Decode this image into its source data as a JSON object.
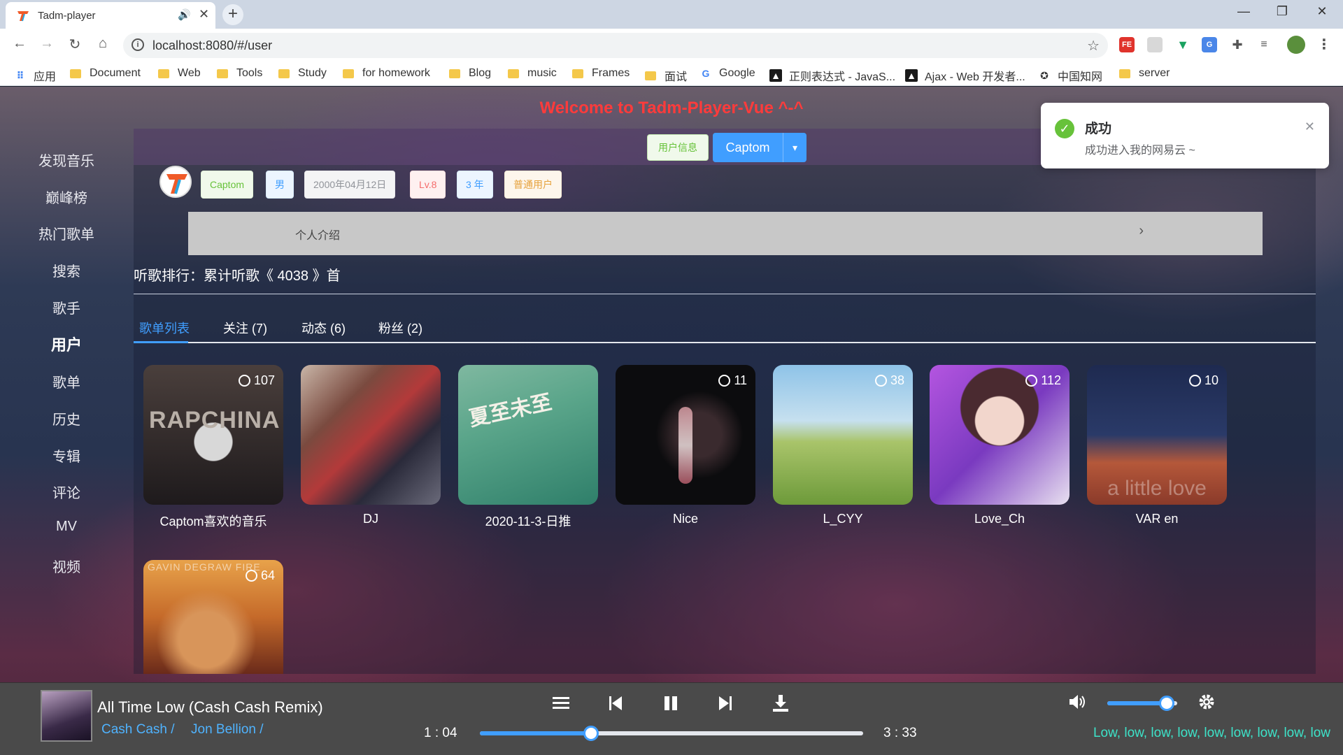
{
  "browser": {
    "tab_title": "Tadm-player",
    "url": "localhost:8080/#/user",
    "bookmarks": [
      "应用",
      "Document",
      "Web",
      "Tools",
      "Study",
      "for homework",
      "Blog",
      "music",
      "Frames",
      "面试",
      "Google",
      "正则表达式 - JavaS...",
      "Ajax - Web 开发者...",
      "中国知网",
      "server"
    ]
  },
  "app": {
    "welcome": "Welcome to Tadm-Player-Vue ^-^",
    "sidebar": [
      "发现音乐",
      "巅峰榜",
      "热门歌单",
      "搜索",
      "歌手",
      "用户",
      "歌单",
      "历史",
      "专辑",
      "评论",
      "MV",
      "视频"
    ],
    "active_sidebar": "用户"
  },
  "user": {
    "info_button": "用户信息",
    "account_button": "Captom",
    "tags": {
      "name": "Captom",
      "gender": "男",
      "birthday": "2000年04月12日",
      "level": "Lv.8",
      "years": "3 年",
      "type": "普通用户"
    },
    "intro_label": "个人介绍",
    "rank_text": "听歌排行：累计听歌《 4038 》首",
    "tabs": [
      "歌单列表",
      "关注 (7)",
      "动态 (6)",
      "粉丝 (2)"
    ],
    "active_tab": "歌单列表"
  },
  "playlists": [
    {
      "name": "Captom喜欢的音乐",
      "count": "107"
    },
    {
      "name": "DJ",
      "count": ""
    },
    {
      "name": "2020-11-3-日推",
      "count": ""
    },
    {
      "name": "Nice",
      "count": "11"
    },
    {
      "name": "L_CYY",
      "count": "38"
    },
    {
      "name": "Love_Ch",
      "count": "112"
    },
    {
      "name": "VAR en",
      "count": "10"
    },
    {
      "name": "",
      "count": "64"
    }
  ],
  "player": {
    "title": "All Time Low (Cash Cash Remix)",
    "artists": [
      "Cash Cash /",
      "Jon Bellion /"
    ],
    "current_time": "1 : 04",
    "total_time": "3 : 33",
    "progress_fraction": 0.29,
    "volume_fraction": 0.85,
    "lyric": "Low, low, low, low, low, low, low, low, low"
  },
  "notification": {
    "title": "成功",
    "message": "成功进入我的网易云 ~"
  },
  "colors": {
    "accent": "#409eff",
    "welcome": "#ff3b3b",
    "success": "#67c23a",
    "lyric": "#3de3c9"
  }
}
